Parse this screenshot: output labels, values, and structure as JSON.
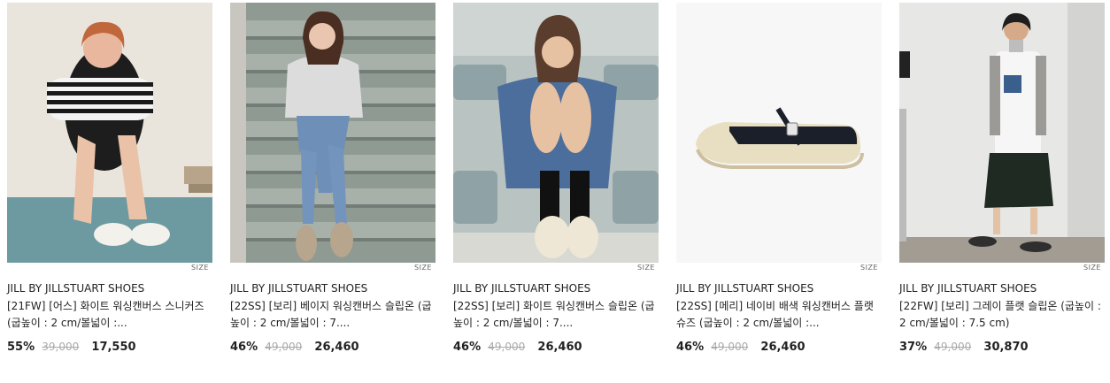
{
  "products": [
    {
      "brand": "JILL BY JILLSTUART SHOES",
      "name": "[21FW] [어스] 화이트 워싱캔버스 스니커즈 (굽높이 : 2 cm/볼넓이 :...",
      "discount": "55%",
      "original_price": "39,000",
      "price": "17,550",
      "size_label": "SIZE",
      "image": "model-sitting-white-sneakers"
    },
    {
      "brand": "JILL BY JILLSTUART SHOES",
      "name": "[22SS] [보리] 베이지 워싱캔버스 슬립온 (굽높이 : 2 cm/볼넓이 : 7....",
      "discount": "46%",
      "original_price": "49,000",
      "price": "26,460",
      "size_label": "SIZE",
      "image": "model-stairs-beige-slipon"
    },
    {
      "brand": "JILL BY JILLSTUART SHOES",
      "name": "[22SS] [보리] 화이트 워싱캔버스 슬립온 (굽높이 : 2 cm/볼넓이 : 7....",
      "discount": "46%",
      "original_price": "49,000",
      "price": "26,460",
      "size_label": "SIZE",
      "image": "model-stadium-white-slipon"
    },
    {
      "brand": "JILL BY JILLSTUART SHOES",
      "name": "[22SS] [메리] 네이비 배색 워싱캔버스 플랫슈즈 (굽높이 : 2 cm/볼넓이 :...",
      "discount": "46%",
      "original_price": "49,000",
      "price": "26,460",
      "size_label": "SIZE",
      "image": "navy-mary-jane-flat"
    },
    {
      "brand": "JILL BY JILLSTUART SHOES",
      "name": "[22FW] [보리] 그레이 플랫 슬립온 (굽높이 : 2 cm/볼넓이 : 7.5 cm)",
      "discount": "37%",
      "original_price": "49,000",
      "price": "30,870",
      "size_label": "SIZE",
      "image": "model-walking-black-slipon"
    }
  ]
}
